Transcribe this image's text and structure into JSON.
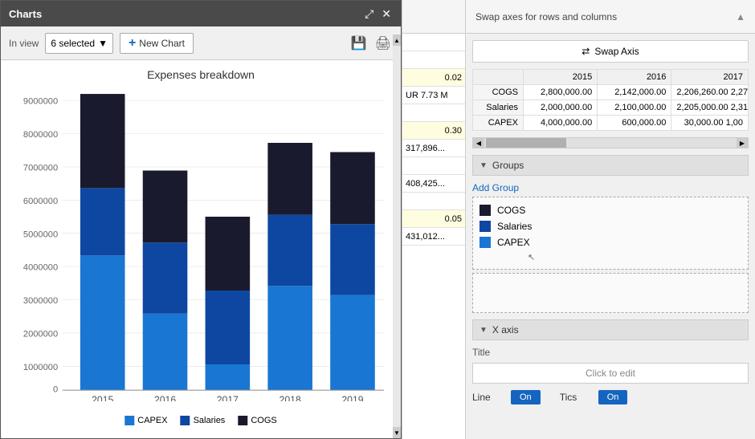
{
  "charts_window": {
    "title": "Charts",
    "toolbar": {
      "in_view_label": "In view",
      "selected_count": "6 selected",
      "new_chart_label": "New Chart"
    },
    "chart": {
      "title": "Expenses breakdown",
      "y_axis_labels": [
        "9000000",
        "8000000",
        "7000000",
        "6000000",
        "5000000",
        "4000000",
        "3000000",
        "2000000",
        "1000000",
        "0"
      ],
      "x_axis_labels": [
        "2015",
        "2016",
        "2017",
        "2018",
        "2019"
      ],
      "legend": [
        {
          "label": "CAPEX",
          "color": "#1976d2"
        },
        {
          "label": "Salaries",
          "color": "#0d47a1"
        },
        {
          "label": "COGS",
          "color": "#1a1a2e"
        }
      ]
    }
  },
  "spreadsheet": {
    "cells": [
      {
        "value": "",
        "type": "normal"
      },
      {
        "value": "",
        "type": "normal"
      },
      {
        "value": "0.02",
        "type": "yellow"
      },
      {
        "value": "UR 7.73 M",
        "type": "normal"
      },
      {
        "value": "",
        "type": "normal"
      },
      {
        "value": "0.30",
        "type": "yellow"
      },
      {
        "value": "317,896...",
        "type": "normal"
      },
      {
        "value": "",
        "type": "normal"
      },
      {
        "value": "408,425...",
        "type": "normal"
      },
      {
        "value": "",
        "type": "normal"
      },
      {
        "value": "0.05",
        "type": "yellow"
      },
      {
        "value": "431,012...",
        "type": "normal"
      }
    ]
  },
  "right_panel": {
    "swap_axes_label": "Swap axes for rows and columns",
    "swap_axis_btn": "⇄ Swap Axis",
    "table": {
      "years": [
        "2015",
        "2016",
        "2017"
      ],
      "rows": [
        {
          "label": "COGS",
          "values": [
            "2,800,000.00",
            "2,142,000.00",
            "2,206,260.00 2,27"
          ]
        },
        {
          "label": "Salaries",
          "values": [
            "2,000,000.00",
            "2,100,000.00",
            "2,205,000.00 2,31"
          ]
        },
        {
          "label": "CAPEX",
          "values": [
            "4,000,000.00",
            "600,000.00",
            "30,000.00 1,00"
          ]
        }
      ]
    },
    "groups_section": {
      "title": "Groups",
      "add_group_label": "Add Group",
      "items": [
        {
          "label": "COGS",
          "color": "#1a1a2e"
        },
        {
          "label": "Salaries",
          "color": "#0d47a1"
        },
        {
          "label": "CAPEX",
          "color": "#1976d2"
        }
      ]
    },
    "x_axis_section": {
      "title": "X axis",
      "title_label": "Title",
      "click_to_edit": "Click to edit",
      "line_label": "Line",
      "line_on": "On",
      "tics_label": "Tics",
      "tics_on": "On"
    }
  }
}
